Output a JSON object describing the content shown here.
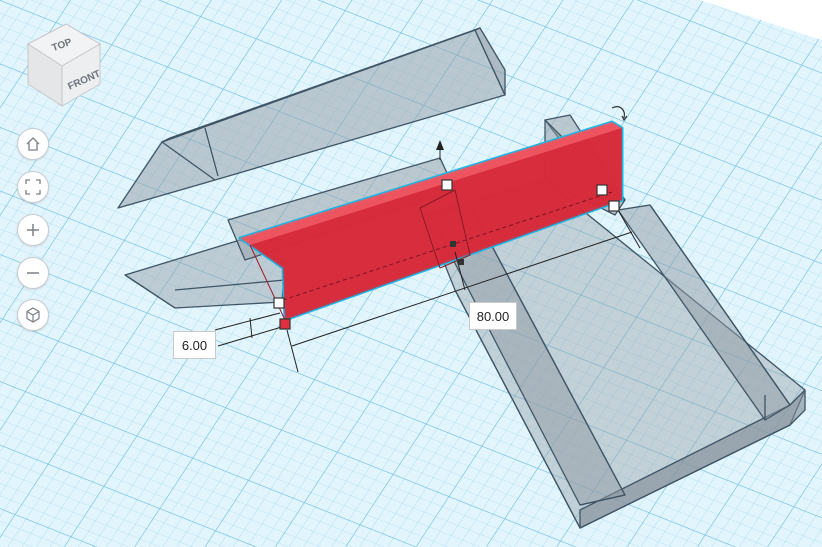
{
  "view_cube": {
    "top_label": "TOP",
    "front_label": "FRONT"
  },
  "nav": {
    "home": "home-icon",
    "fit": "fit-view-icon",
    "zoom_in": "zoom-in-icon",
    "zoom_out": "zoom-out-icon",
    "perspective": "perspective-cube-icon"
  },
  "dimensions": {
    "height": "6.00",
    "length": "80.00"
  },
  "colors": {
    "grid_bg": "#dff3fb",
    "grid_line": "#a9dcf0",
    "grid_major": "#7fc7e6",
    "selected_fill": "#e0303f",
    "selected_outline": "#19b8e8",
    "hole_fill": "#9aa3ab"
  }
}
